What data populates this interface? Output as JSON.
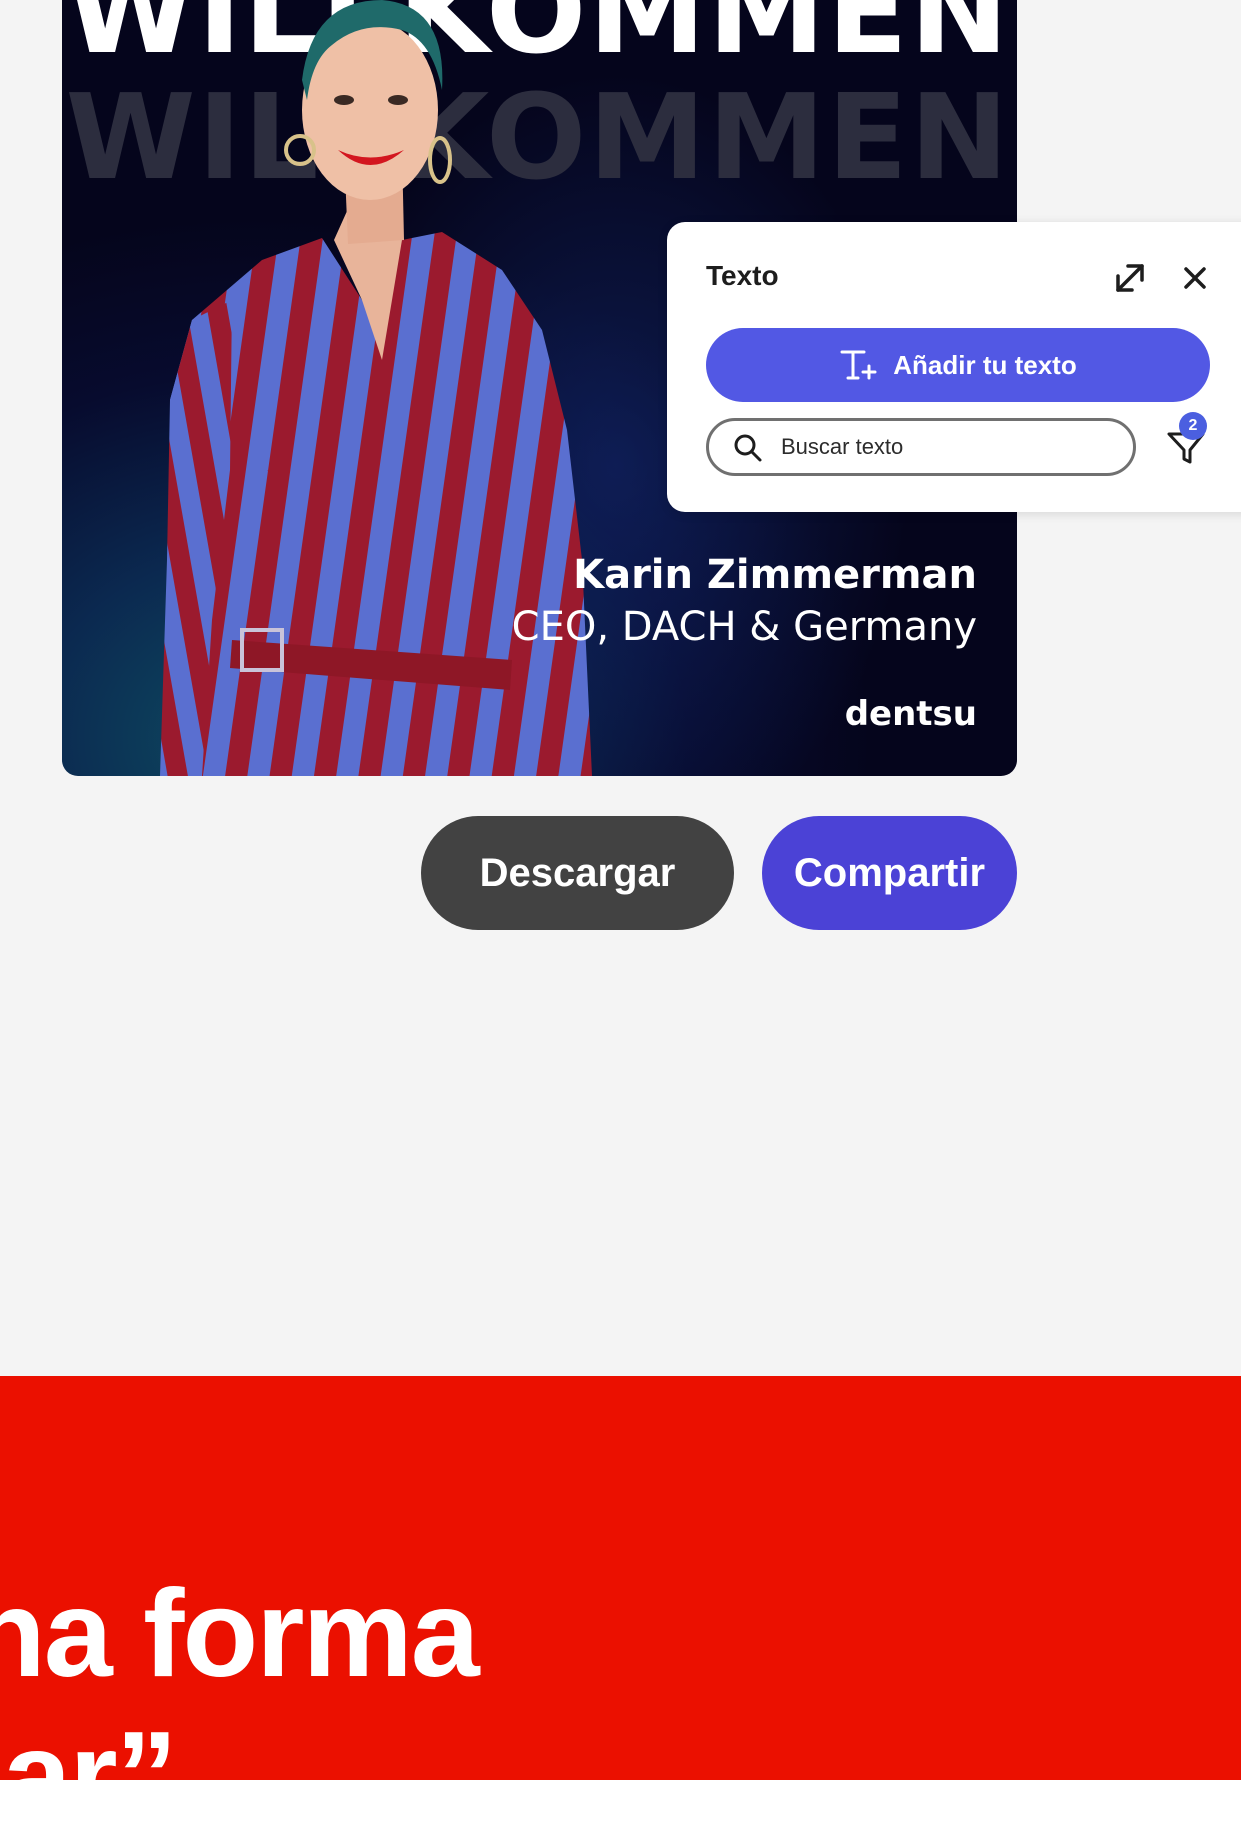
{
  "poster": {
    "headline_front": "WILLKOMMEN",
    "headline_back": "WILLKOMMEN",
    "name": "Karin Zimmerman",
    "role": "CEO, DACH & Germany",
    "brand": "dentsu"
  },
  "actions": {
    "download_label": "Descargar",
    "share_label": "Compartir"
  },
  "text_panel": {
    "title": "Texto",
    "add_text_label": "Añadir tu texto",
    "search_placeholder": "Buscar texto",
    "filter_count": "2"
  },
  "hero": {
    "line1": "na forma",
    "line2": "iar”"
  },
  "colors": {
    "page_background": "#f4f4f4",
    "download_button": "#424242",
    "share_button": "#4b42d6",
    "add_text_button": "#5258e4",
    "hero_band": "#eb1000"
  },
  "icons": {
    "panel_expand": "expand-arrows-icon",
    "panel_close": "close-icon",
    "add_text": "text-add-icon",
    "search": "search-icon",
    "filter": "filter-icon"
  }
}
